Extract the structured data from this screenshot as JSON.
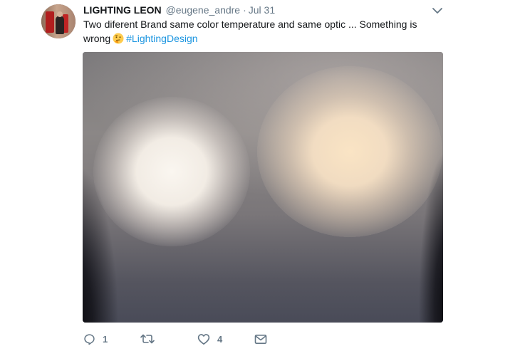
{
  "tweet": {
    "author_name": "LIGHTING LEON",
    "author_handle": "@eugene_andre",
    "separator": "·",
    "date": "Jul 31",
    "text_part1": "Two diferent Brand same color temperature and same optic ... Something is wrong",
    "emoji": "thinking-face",
    "hashtag": "#LightingDesign"
  },
  "actions": {
    "reply_count": "1",
    "retweet_count": "",
    "like_count": "4"
  },
  "icons": {
    "caret": "chevron-down-icon",
    "reply": "reply-icon",
    "retweet": "retweet-icon",
    "like": "heart-icon",
    "dm": "envelope-icon"
  },
  "colors": {
    "text": "#14171a",
    "secondary": "#657786",
    "link": "#1b95e0"
  }
}
